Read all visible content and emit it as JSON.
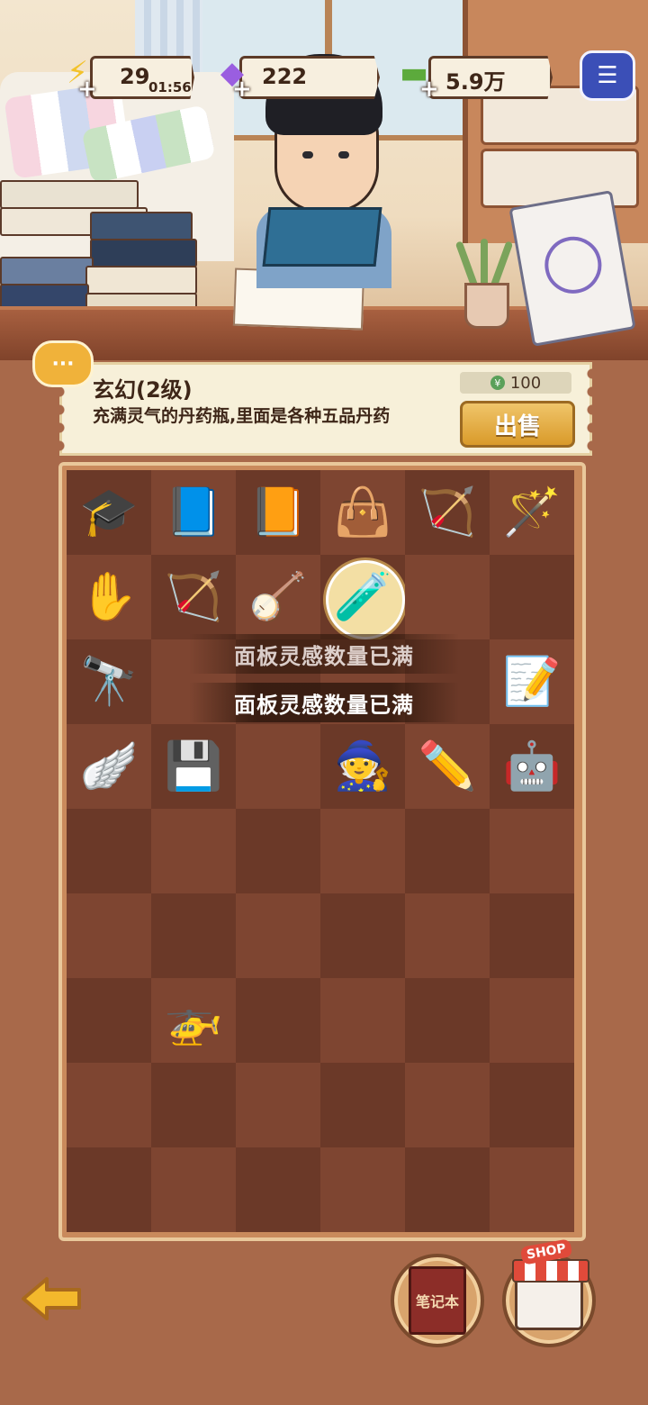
{
  "resources": {
    "energy": {
      "value": "29",
      "timer": "01:56",
      "icon": "lightning-icon"
    },
    "gems": {
      "value": "222",
      "icon": "diamond-icon"
    },
    "cash": {
      "value": "5.9万",
      "icon": "cash-icon"
    },
    "plus": "+"
  },
  "help_icon": "☰",
  "selected_item": {
    "title": "玄幻(2级)",
    "description": "充满灵气的丹药瓶,里面是各种五品丹药",
    "price": "100",
    "price_icon": "¥",
    "sell_label": "出售"
  },
  "toasts": [
    "面板灵感数量已满",
    "面板灵感数量已满"
  ],
  "board": {
    "rows": 9,
    "cols": 6,
    "items": [
      {
        "row": 0,
        "col": 0,
        "name": "graduation-cap",
        "glyph": "🎓"
      },
      {
        "row": 0,
        "col": 1,
        "name": "ancient-book",
        "glyph": "📘"
      },
      {
        "row": 0,
        "col": 2,
        "name": "exam-book",
        "glyph": "📙"
      },
      {
        "row": 0,
        "col": 3,
        "name": "handbag",
        "glyph": "👜"
      },
      {
        "row": 0,
        "col": 4,
        "name": "bow",
        "glyph": "🏹"
      },
      {
        "row": 0,
        "col": 5,
        "name": "magic-staff",
        "glyph": "🪄"
      },
      {
        "row": 1,
        "col": 0,
        "name": "buddha-hand",
        "glyph": "✋"
      },
      {
        "row": 1,
        "col": 1,
        "name": "bow",
        "glyph": "🏹"
      },
      {
        "row": 1,
        "col": 2,
        "name": "harp",
        "glyph": "🪕"
      },
      {
        "row": 1,
        "col": 3,
        "name": "elixir-bottle",
        "glyph": "🧪",
        "selected": true
      },
      {
        "row": 2,
        "col": 0,
        "name": "cannon",
        "glyph": "🔭"
      },
      {
        "row": 2,
        "col": 5,
        "name": "exam-paper",
        "glyph": "📝"
      },
      {
        "row": 3,
        "col": 0,
        "name": "angel-wings",
        "glyph": "🪽"
      },
      {
        "row": 3,
        "col": 1,
        "name": "chip",
        "glyph": "💾"
      },
      {
        "row": 3,
        "col": 3,
        "name": "witch-hat",
        "glyph": "🧙"
      },
      {
        "row": 3,
        "col": 4,
        "name": "pencil",
        "glyph": "✏️"
      },
      {
        "row": 3,
        "col": 5,
        "name": "robot",
        "glyph": "🤖"
      },
      {
        "row": 6,
        "col": 1,
        "name": "drone",
        "glyph": "🚁"
      }
    ]
  },
  "buttons": {
    "back_icon": "back-arrow-icon",
    "notebook_label": "笔记本",
    "shop_label": "SHOP"
  },
  "colors": {
    "cell_dark": "#6b3928",
    "cell_light": "#7e4531",
    "accent": "#f0b23a"
  }
}
